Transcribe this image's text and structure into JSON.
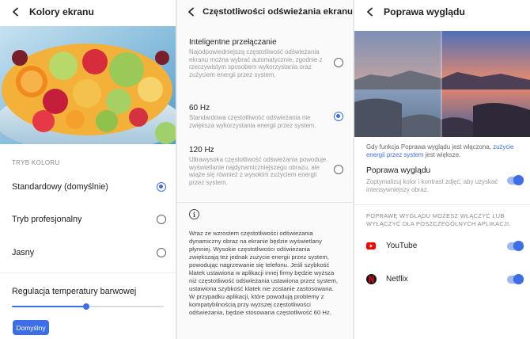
{
  "panel1": {
    "title": "Kolory ekranu",
    "section_label": "TRYB KOLORU",
    "options": [
      {
        "label": "Standardowy (domyślnie)",
        "selected": true
      },
      {
        "label": "Tryb profesjonalny",
        "selected": false
      },
      {
        "label": "Jasny",
        "selected": false
      }
    ],
    "temperature_label": "Regulacja temperatury barwowej",
    "temperature_level": 0.49,
    "default_button": "Domyślny"
  },
  "panel2": {
    "title": "Częstotliwości odświeżania ekranu",
    "options": [
      {
        "title": "Inteligentne przełączanie",
        "desc": "Najodpowiedniejszą częstotliwość odświeżania ekranu można wybrać automatycznie, zgodnie z rzeczywistym sposobem wykorzystania oraz zużyciem energii przez system.",
        "selected": false
      },
      {
        "title": "60 Hz",
        "desc": "Standardowa częstotliwość odświeżania nie zwiększa wykorzystania energii przez system.",
        "selected": true
      },
      {
        "title": "120 Hz",
        "desc": "Ultrawysoka częstotliwość odświeżania powoduje wyświetlanie najdynamiczniejszego obrazu, ale wiąże się również z wysokim zużyciem energii przez system.",
        "selected": false
      }
    ],
    "info_icon": "info-icon",
    "info_text": "Wraz ze wzrostem częstotliwości odświeżania dynamiczny obraz na ekranie będzie wyświetlany płynniej. Wysokie częstotliwości odświeżania zwiększają też jednak zużycie energii przez system, powodując nagrzewanie się telefonu. Jeśli szybkość klatek ustawiona w aplikacji innej firmy będzie wyższa niż częstotliwość odświeżania ustawiona przez system, ustawiona szybkość klatek nie zostanie zastosowana. W przypadku aplikacji, które powodują problemy z kompatybilnością przy wyższej częstotliwości odświeżania, będzie stosowana częstotliwość 60 Hz."
  },
  "panel3": {
    "title": "Poprawa wyglądu",
    "note_prefix": "Gdy funkcja Poprawa wyglądu jest włączona, ",
    "note_link": "zużycie energii przez system",
    "note_suffix": " jest większe.",
    "toggle_title": "Poprawa wyglądu",
    "toggle_desc": "Zoptymalizuj kolor i kontrast zdjęć, aby uzyskać intensywniejszy obraz.",
    "toggle_on": true,
    "apps_section": "POPRAWĘ WYGLĄDU MOŻESZ WŁĄCZYĆ LUB WYŁĄCZYĆ DLA POSZCZEGÓLNYCH APLIKACJI.",
    "apps": [
      {
        "name": "YouTube",
        "icon": "youtube-icon",
        "color": "#ff0000",
        "on": true
      },
      {
        "name": "Netflix",
        "icon": "netflix-icon",
        "color": "#e50914",
        "on": true
      }
    ]
  },
  "colors": {
    "accent": "#3d6ee8",
    "link": "#3d6ee8"
  }
}
